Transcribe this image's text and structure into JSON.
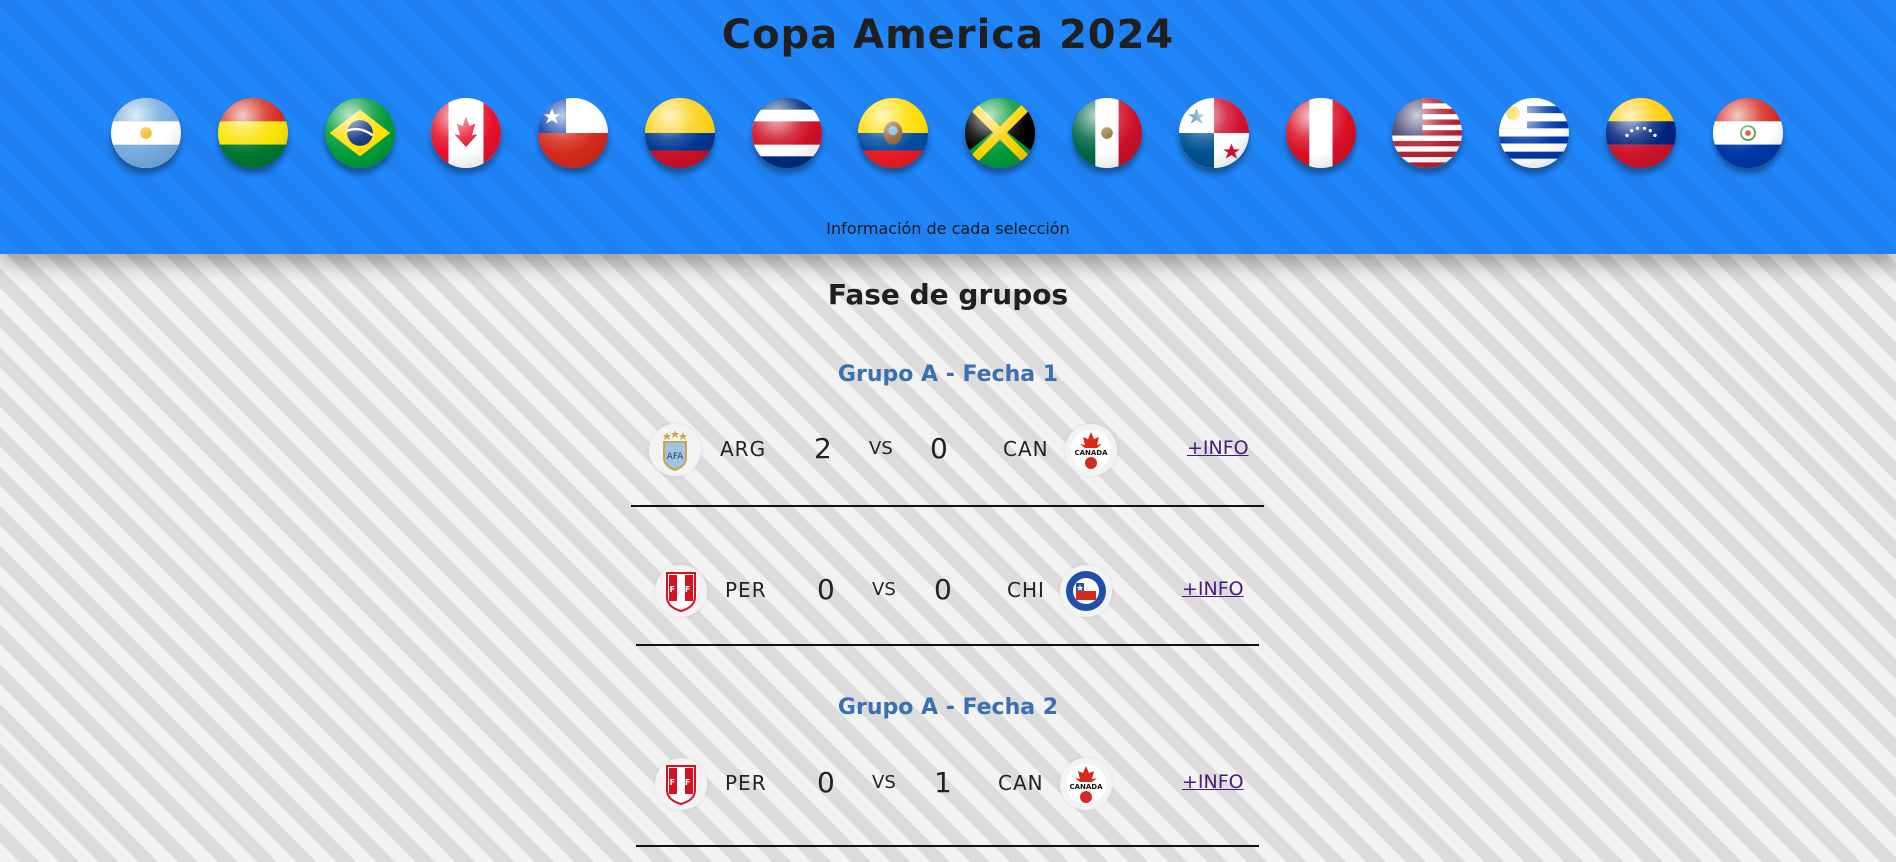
{
  "header": {
    "title": "Copa America 2024",
    "caption": "Información de cada selección",
    "flags": [
      {
        "name": "argentina-flag-icon"
      },
      {
        "name": "bolivia-flag-icon"
      },
      {
        "name": "brazil-flag-icon"
      },
      {
        "name": "canada-flag-icon"
      },
      {
        "name": "chile-flag-icon"
      },
      {
        "name": "colombia-flag-icon"
      },
      {
        "name": "costa-rica-flag-icon"
      },
      {
        "name": "ecuador-flag-icon"
      },
      {
        "name": "jamaica-flag-icon"
      },
      {
        "name": "mexico-flag-icon"
      },
      {
        "name": "panama-flag-icon"
      },
      {
        "name": "peru-flag-icon"
      },
      {
        "name": "usa-flag-icon"
      },
      {
        "name": "uruguay-flag-icon"
      },
      {
        "name": "venezuela-flag-icon"
      },
      {
        "name": "paraguay-flag-icon"
      }
    ]
  },
  "main": {
    "section_title": "Fase de grupos",
    "groups": [
      {
        "title": "Grupo A - Fecha 1",
        "matches": [
          {
            "home": "ARG",
            "home_score": "2",
            "vs": "VS",
            "away_score": "0",
            "away": "CAN",
            "more": "+INFO",
            "home_logo": "afa-crest-icon",
            "away_logo": "canada-soccer-crest-icon"
          },
          {
            "home": "PER",
            "home_score": "0",
            "vs": "VS",
            "away_score": "0",
            "away": "CHI",
            "more": "+INFO",
            "home_logo": "fpf-crest-icon",
            "away_logo": "chile-federation-crest-icon"
          }
        ]
      },
      {
        "title": "Grupo A - Fecha 2",
        "matches": [
          {
            "home": "PER",
            "home_score": "0",
            "vs": "VS",
            "away_score": "1",
            "away": "CAN",
            "more": "+INFO",
            "home_logo": "fpf-crest-icon",
            "away_logo": "canada-soccer-crest-icon"
          }
        ]
      }
    ]
  },
  "colors": {
    "header_blue": "#2086fb",
    "group_title": "#3a6fb0",
    "link": "#4b1a7a"
  }
}
